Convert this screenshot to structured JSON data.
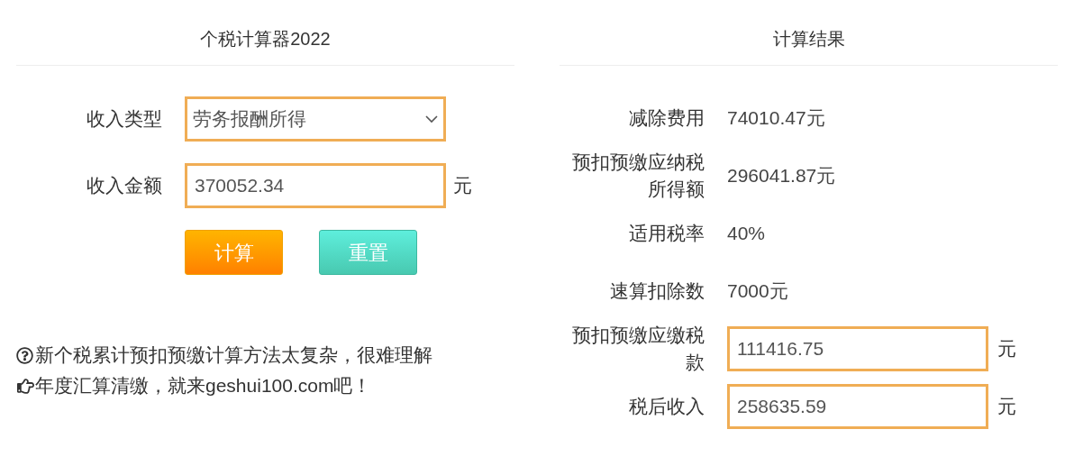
{
  "calculator": {
    "title": "个税计算器2022",
    "fields": [
      {
        "kind": "select",
        "label": "收入类型",
        "value": "劳务报酬所得"
      },
      {
        "kind": "input",
        "label": "收入金额",
        "value": "370052.34",
        "unit": "元"
      }
    ],
    "buttons": [
      {
        "kind": "primary",
        "label": "计算"
      },
      {
        "kind": "secondary",
        "label": "重置"
      }
    ],
    "notes": [
      {
        "kind": "question",
        "text": "新个税累计预扣预缴计算方法太复杂，很难理解"
      },
      {
        "kind": "pointer",
        "text": "年度汇算清缴，就来geshui100.com吧！"
      }
    ]
  },
  "results": {
    "title": "计算结果",
    "rows": [
      {
        "kind": "text",
        "label": "减除费用",
        "value": "74010.47元"
      },
      {
        "kind": "text",
        "label": "预扣预缴应纳税所得额",
        "value": "296041.87元"
      },
      {
        "kind": "text",
        "label": "适用税率",
        "value": "40%"
      },
      {
        "kind": "text",
        "label": "速算扣除数",
        "value": "7000元"
      },
      {
        "kind": "field",
        "label": "预扣预缴应缴税款",
        "value": "111416.75",
        "unit": "元"
      },
      {
        "kind": "field",
        "label": "税后收入",
        "value": "258635.59",
        "unit": "元"
      }
    ]
  }
}
